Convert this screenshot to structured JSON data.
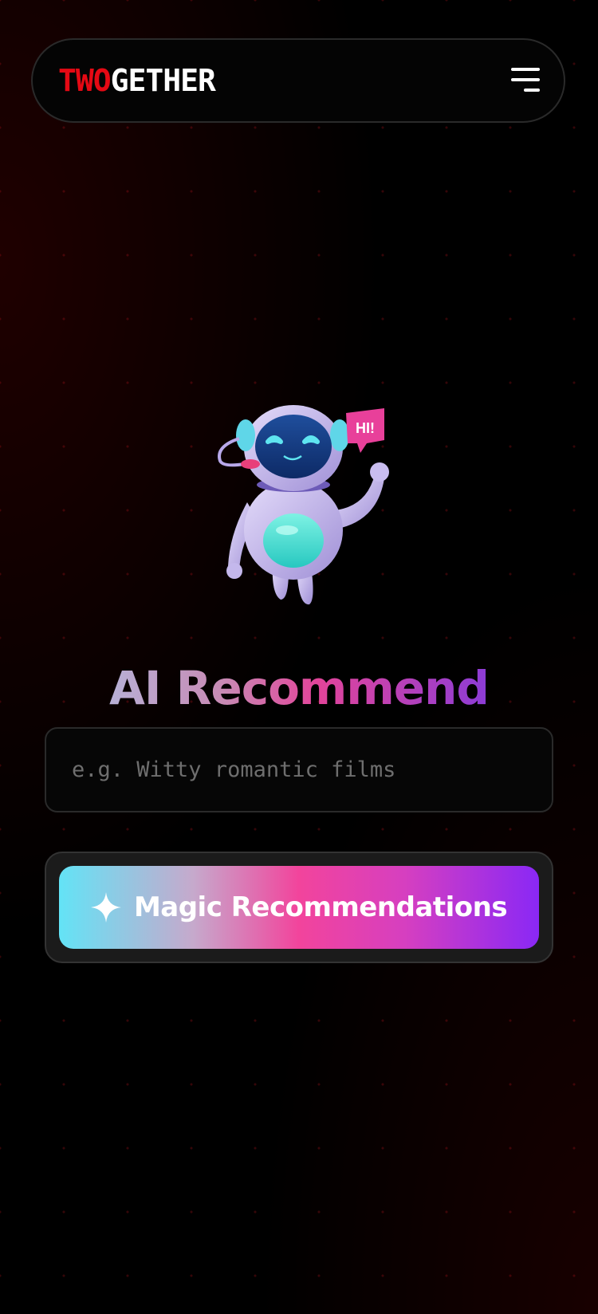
{
  "header": {
    "logo_part1": "TWO",
    "logo_part2": "GETHER",
    "menu_icon": "hamburger-menu-icon"
  },
  "hero": {
    "illustration": "robot-mascot",
    "speech_bubble_text": "HI!",
    "title": "AI Recommend"
  },
  "search": {
    "placeholder": "e.g. Witty romantic films",
    "value": ""
  },
  "action": {
    "icon": "sparkle-icon",
    "label": "Magic Recommendations"
  },
  "colors": {
    "brand_red": "#e50914",
    "gradient_start": "#63e3f6",
    "gradient_mid": "#f2449c",
    "gradient_end": "#8a28f5"
  }
}
